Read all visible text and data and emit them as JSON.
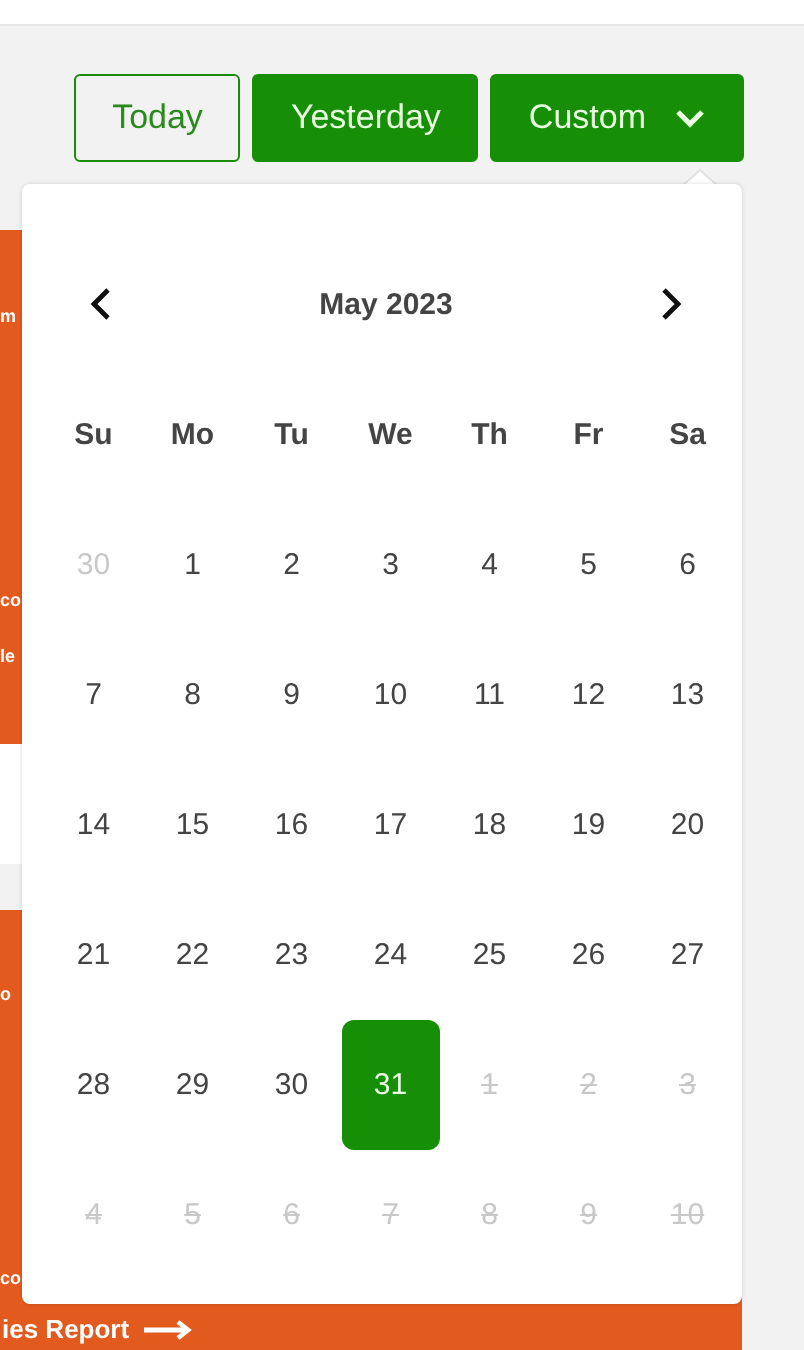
{
  "range_buttons": [
    {
      "label": "Today",
      "selected": false,
      "dropdown": false
    },
    {
      "label": "Yesterday",
      "selected": true,
      "dropdown": false
    },
    {
      "label": "Custom",
      "selected": true,
      "dropdown": true
    }
  ],
  "background_cards": [
    {
      "texts": [
        "m",
        "co",
        "le"
      ]
    },
    {
      "texts": [
        "o",
        "co"
      ],
      "link": "ies Report"
    }
  ],
  "calendar": {
    "title": "May 2023",
    "weekdays": [
      "Su",
      "Mo",
      "Tu",
      "We",
      "Th",
      "Fr",
      "Sa"
    ],
    "days": [
      {
        "label": "30",
        "outside": true,
        "disabled": false,
        "selected": false
      },
      {
        "label": "1",
        "outside": false,
        "disabled": false,
        "selected": false
      },
      {
        "label": "2",
        "outside": false,
        "disabled": false,
        "selected": false
      },
      {
        "label": "3",
        "outside": false,
        "disabled": false,
        "selected": false
      },
      {
        "label": "4",
        "outside": false,
        "disabled": false,
        "selected": false
      },
      {
        "label": "5",
        "outside": false,
        "disabled": false,
        "selected": false
      },
      {
        "label": "6",
        "outside": false,
        "disabled": false,
        "selected": false
      },
      {
        "label": "7",
        "outside": false,
        "disabled": false,
        "selected": false
      },
      {
        "label": "8",
        "outside": false,
        "disabled": false,
        "selected": false
      },
      {
        "label": "9",
        "outside": false,
        "disabled": false,
        "selected": false
      },
      {
        "label": "10",
        "outside": false,
        "disabled": false,
        "selected": false
      },
      {
        "label": "11",
        "outside": false,
        "disabled": false,
        "selected": false
      },
      {
        "label": "12",
        "outside": false,
        "disabled": false,
        "selected": false
      },
      {
        "label": "13",
        "outside": false,
        "disabled": false,
        "selected": false
      },
      {
        "label": "14",
        "outside": false,
        "disabled": false,
        "selected": false
      },
      {
        "label": "15",
        "outside": false,
        "disabled": false,
        "selected": false
      },
      {
        "label": "16",
        "outside": false,
        "disabled": false,
        "selected": false
      },
      {
        "label": "17",
        "outside": false,
        "disabled": false,
        "selected": false
      },
      {
        "label": "18",
        "outside": false,
        "disabled": false,
        "selected": false
      },
      {
        "label": "19",
        "outside": false,
        "disabled": false,
        "selected": false
      },
      {
        "label": "20",
        "outside": false,
        "disabled": false,
        "selected": false
      },
      {
        "label": "21",
        "outside": false,
        "disabled": false,
        "selected": false
      },
      {
        "label": "22",
        "outside": false,
        "disabled": false,
        "selected": false
      },
      {
        "label": "23",
        "outside": false,
        "disabled": false,
        "selected": false
      },
      {
        "label": "24",
        "outside": false,
        "disabled": false,
        "selected": false
      },
      {
        "label": "25",
        "outside": false,
        "disabled": false,
        "selected": false
      },
      {
        "label": "26",
        "outside": false,
        "disabled": false,
        "selected": false
      },
      {
        "label": "27",
        "outside": false,
        "disabled": false,
        "selected": false
      },
      {
        "label": "28",
        "outside": false,
        "disabled": false,
        "selected": false
      },
      {
        "label": "29",
        "outside": false,
        "disabled": false,
        "selected": false
      },
      {
        "label": "30",
        "outside": false,
        "disabled": false,
        "selected": false
      },
      {
        "label": "31",
        "outside": false,
        "disabled": false,
        "selected": true
      },
      {
        "label": "1",
        "outside": true,
        "disabled": true,
        "selected": false
      },
      {
        "label": "2",
        "outside": true,
        "disabled": true,
        "selected": false
      },
      {
        "label": "3",
        "outside": true,
        "disabled": true,
        "selected": false
      },
      {
        "label": "4",
        "outside": true,
        "disabled": true,
        "selected": false
      },
      {
        "label": "5",
        "outside": true,
        "disabled": true,
        "selected": false
      },
      {
        "label": "6",
        "outside": true,
        "disabled": true,
        "selected": false
      },
      {
        "label": "7",
        "outside": true,
        "disabled": true,
        "selected": false
      },
      {
        "label": "8",
        "outside": true,
        "disabled": true,
        "selected": false
      },
      {
        "label": "9",
        "outside": true,
        "disabled": true,
        "selected": false
      },
      {
        "label": "10",
        "outside": true,
        "disabled": true,
        "selected": false
      }
    ]
  }
}
